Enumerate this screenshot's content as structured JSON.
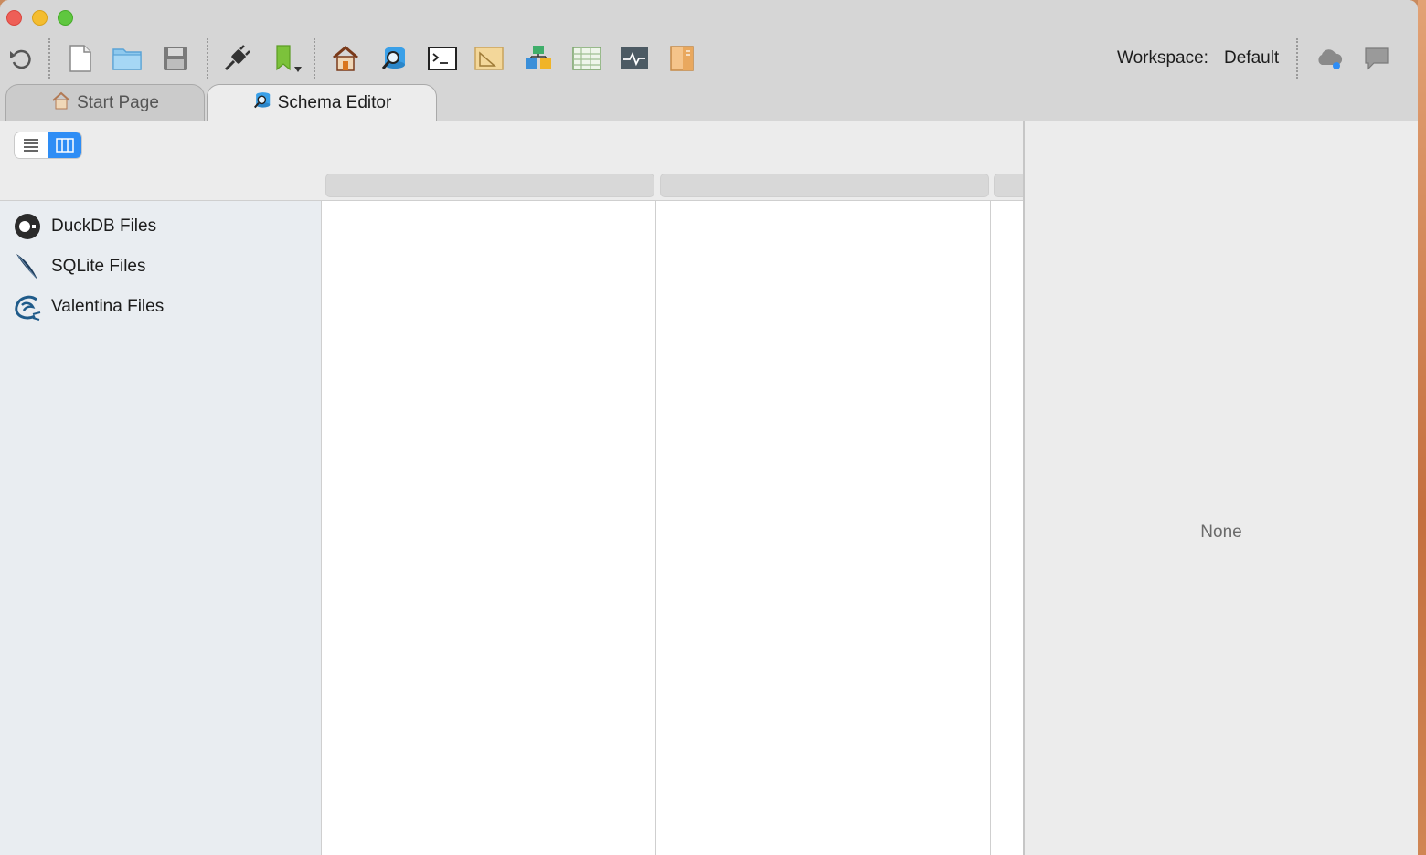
{
  "toolbar": {
    "workspace_label": "Workspace:",
    "workspace_value": "Default",
    "icons": [
      "undo-icon",
      "new-file-icon",
      "open-folder-icon",
      "save-icon",
      "connect-plug-icon",
      "bookmark-icon",
      "home-icon",
      "schema-editor-icon",
      "terminal-icon",
      "ruler-icon",
      "diagram-icon",
      "table-grid-icon",
      "activity-monitor-icon",
      "notebook-icon",
      "cloud-icon",
      "chat-icon"
    ]
  },
  "tabs": [
    {
      "label": "Start Page",
      "icon": "home-icon",
      "active": false
    },
    {
      "label": "Schema Editor",
      "icon": "schema-editor-icon",
      "active": true
    }
  ],
  "sidebar": {
    "items": [
      {
        "label": "DuckDB Files",
        "icon": "duckdb-icon"
      },
      {
        "label": "SQLite Files",
        "icon": "sqlite-feather-icon"
      },
      {
        "label": "Valentina Files",
        "icon": "valentina-dragon-icon"
      }
    ]
  },
  "inspector": {
    "empty_label": "None"
  },
  "colors": {
    "accent": "#2e8df5",
    "window_bg": "#d6d6d6",
    "sidebar_bg": "#e9edf1"
  }
}
